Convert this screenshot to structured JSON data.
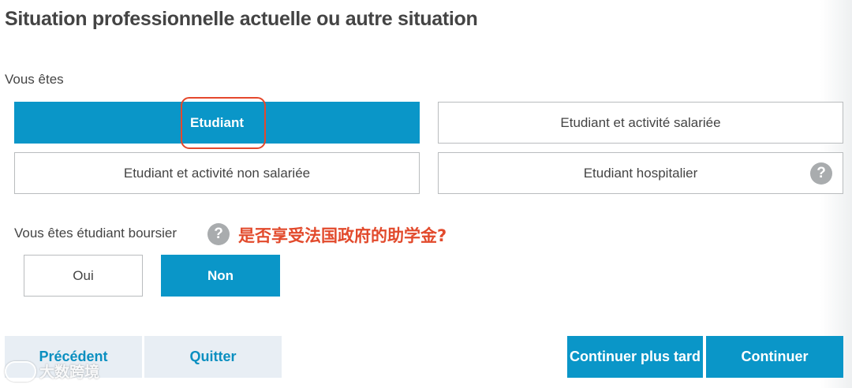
{
  "title": "Situation professionnelle actuelle ou autre situation",
  "situation": {
    "label": "Vous êtes",
    "options": [
      {
        "label": "Etudiant",
        "selected": true
      },
      {
        "label": "Etudiant et activité salariée",
        "selected": false
      },
      {
        "label": "Etudiant et activité non salariée",
        "selected": false
      },
      {
        "label": "Etudiant hospitalier",
        "selected": false
      }
    ],
    "help_icon": "question-circle-icon"
  },
  "boursier": {
    "label": "Vous êtes étudiant boursier",
    "help_icon": "question-circle-icon",
    "annotation": "是否享受法国政府的助学金?",
    "options": [
      {
        "label": "Oui",
        "selected": false
      },
      {
        "label": "Non",
        "selected": true
      }
    ]
  },
  "footer": {
    "previous": "Précédent",
    "quit": "Quitter",
    "later": "Continuer plus tard",
    "continue": "Continuer"
  },
  "watermark": "大数跨境",
  "colors": {
    "accent": "#0a96c8",
    "annotation": "#e24a2c",
    "secondary_button_bg": "#e8eef4"
  }
}
